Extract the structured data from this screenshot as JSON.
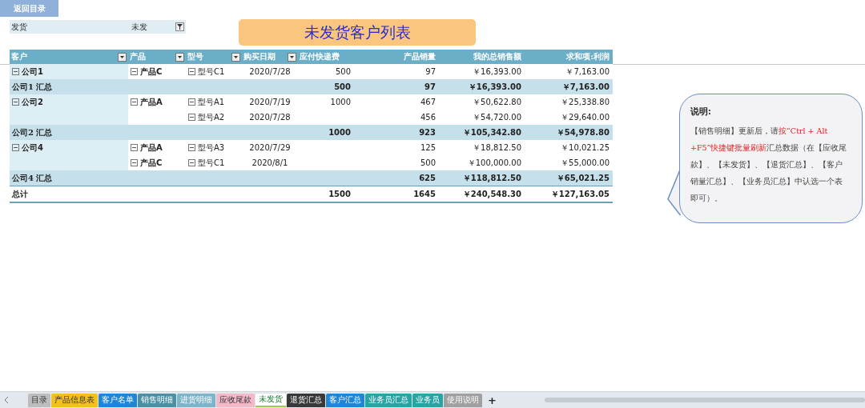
{
  "back_button": {
    "label": "返回目录"
  },
  "filter": {
    "label": "发货",
    "value": "未发"
  },
  "title": "未发货客户列表",
  "table": {
    "columns": [
      {
        "label": "客户",
        "filter": true
      },
      {
        "label": "产品",
        "filter": true
      },
      {
        "label": "型号",
        "filter": true
      },
      {
        "label": "购买日期",
        "filter": true
      },
      {
        "label": "应付快递费",
        "filter": false
      },
      {
        "label": "产品销量",
        "filter": false
      },
      {
        "label": "我的总销售额",
        "filter": false
      },
      {
        "label": "求和项:利润",
        "filter": false
      }
    ],
    "rows": [
      {
        "kind": "detail",
        "customer": "公司1",
        "customer_expanded": true,
        "product": "产品C",
        "product_expanded": true,
        "model": "型号C1",
        "model_expanded": true,
        "date": "2020/7/28",
        "fee": "500",
        "qty": "97",
        "sales": "￥16,393.00",
        "profit": "￥7,163.00"
      },
      {
        "kind": "subtotal",
        "label": "公司1 汇总",
        "fee": "500",
        "qty": "97",
        "sales": "￥16,393.00",
        "profit": "￥7,163.00"
      },
      {
        "kind": "detail",
        "customer": "公司2",
        "customer_expanded": true,
        "product": "产品A",
        "product_expanded": true,
        "model": "型号A1",
        "model_expanded": true,
        "date": "2020/7/19",
        "fee": "1000",
        "qty": "467",
        "sales": "￥50,622.80",
        "profit": "￥25,338.80"
      },
      {
        "kind": "detail",
        "model": "型号A2",
        "model_expanded": true,
        "date": "2020/7/28",
        "qty": "456",
        "sales": "￥54,720.00",
        "profit": "￥29,640.00"
      },
      {
        "kind": "subtotal",
        "label": "公司2 汇总",
        "fee": "1000",
        "qty": "923",
        "sales": "￥105,342.80",
        "profit": "￥54,978.80"
      },
      {
        "kind": "detail",
        "customer": "公司4",
        "customer_expanded": true,
        "product": "产品A",
        "product_expanded": true,
        "model": "型号A3",
        "model_expanded": true,
        "date": "2020/7/29",
        "qty": "125",
        "sales": "￥18,812.50",
        "profit": "￥10,021.25"
      },
      {
        "kind": "detail",
        "product": "产品C",
        "product_expanded": true,
        "model": "型号C1",
        "model_expanded": true,
        "date": "2020/8/1",
        "qty": "500",
        "sales": "￥100,000.00",
        "profit": "￥55,000.00"
      },
      {
        "kind": "subtotal",
        "label": "公司4 汇总",
        "qty": "625",
        "sales": "￥118,812.50",
        "profit": "￥65,021.25"
      },
      {
        "kind": "total",
        "label": "总计",
        "fee": "1500",
        "qty": "1645",
        "sales": "￥240,548.30",
        "profit": "￥127,163.05"
      }
    ]
  },
  "note": {
    "heading": "说明:",
    "segments": [
      {
        "text": "【销售明细】更新后，请",
        "highlight": false
      },
      {
        "text": "按“Ctrl + Alt +F5”快捷键批量刷新",
        "highlight": true
      },
      {
        "text": "汇总数据（在【应收尾款】、【未发货】、【退货汇总】、【客户销量汇总】、【业务员汇总】中认选一个表即可）。",
        "highlight": false
      }
    ]
  },
  "sheet_tabs": [
    {
      "label": "目录",
      "color": "#bdbdbd",
      "selected": false
    },
    {
      "label": "产品信息表",
      "color": "#f2c21b",
      "selected": false
    },
    {
      "label": "客户名单",
      "color": "#1f86d6",
      "selected": false
    },
    {
      "label": "销售明细",
      "color": "#4a8fa3",
      "selected": false
    },
    {
      "label": "进货明细",
      "color": "#7db4c9",
      "selected": false
    },
    {
      "label": "应收尾款",
      "color": "#f3b9c9",
      "selected": false
    },
    {
      "label": "未发货",
      "color": "#a6c84a",
      "selected": true
    },
    {
      "label": "退货汇总",
      "color": "#383838",
      "selected": false
    },
    {
      "label": "客户汇总",
      "color": "#1f86d6",
      "selected": false
    },
    {
      "label": "业务员汇总",
      "color": "#2aa3a3",
      "selected": false
    },
    {
      "label": "业务员",
      "color": "#2aa3a3",
      "selected": false
    },
    {
      "label": "使用说明",
      "color": "#a0a0a0",
      "selected": false
    }
  ],
  "add_sheet": "+"
}
